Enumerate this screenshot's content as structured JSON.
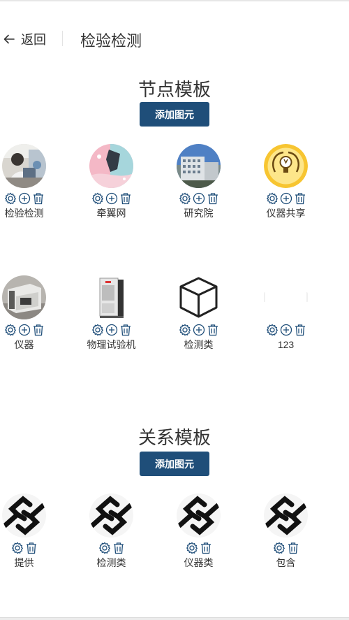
{
  "header": {
    "back_label": "返回",
    "title": "检验检测"
  },
  "node_section": {
    "title": "节点模板",
    "add_button": "添加图元"
  },
  "node_items": [
    {
      "label": "检验检测",
      "image": "lab-photo"
    },
    {
      "label": "牵翼网",
      "image": "pink-illustration"
    },
    {
      "label": "研究院",
      "image": "building-photo"
    },
    {
      "label": "仪器共享",
      "image": "bulb-icon"
    },
    {
      "label": "仪器",
      "image": "instrument-photo"
    },
    {
      "label": "物理试验机",
      "image": "test-chamber"
    },
    {
      "label": "检测类",
      "image": "cube-icon"
    },
    {
      "label": "123",
      "image": "blank"
    }
  ],
  "relation_section": {
    "title": "关系模板",
    "add_button": "添加图元"
  },
  "relation_items": [
    {
      "label": "提供",
      "image": "link-icon"
    },
    {
      "label": "检测类",
      "image": "link-icon"
    },
    {
      "label": "仪器类",
      "image": "link-icon"
    },
    {
      "label": "包含",
      "image": "link-icon"
    }
  ],
  "colors": {
    "accent": "#1f4e79",
    "icon": "#1f4e79"
  }
}
